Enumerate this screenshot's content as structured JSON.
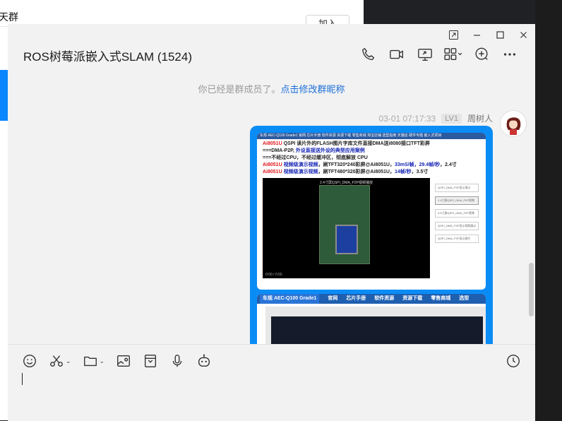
{
  "background_window": {
    "title": "天群",
    "join_label": "加入"
  },
  "window": {
    "title": "ROS树莓派嵌入式SLAM (1524)",
    "controls": [
      "pin-window-icon",
      "minimize-icon",
      "maximize-icon",
      "close-icon"
    ],
    "header_icons": [
      "phone-icon",
      "video-call-icon",
      "screen-share-icon",
      "apps-grid-icon",
      "add-circle-icon",
      "more-icon"
    ]
  },
  "notice": {
    "text": "你已经是群成员了。",
    "link": "点击修改群昵称"
  },
  "message": {
    "timestamp": "03-01 07:17:33",
    "level": "LV1",
    "sender": "周树人",
    "card1": {
      "nav": "车规 AEC-Q100 Grade1    官网    芯片手册    软件资源    资源下载    零售商城    淘宝店铺    选型指南    天猫店    硬件专题    嵌入式项目",
      "lines": [
        {
          "parts": [
            [
              "r",
              "Ai8051U"
            ],
            [
              "k",
              " QSPI"
            ],
            [
              "k",
              " 读片外的FLASH图片字库文件直接DMA送i8080接口TFT彩屏"
            ]
          ]
        },
        {
          "parts": [
            [
              "k",
              "===DMA-P2P, "
            ],
            [
              "b",
              "外设直接送外设的典型应用案例"
            ]
          ]
        },
        {
          "parts": [
            [
              "k",
              "===不经过CPU，不经过缓冲区，彻底解放 CPU"
            ]
          ]
        },
        {
          "parts": [
            [
              "r",
              "Ai8051U "
            ],
            [
              "b",
              "视频级演示视频"
            ],
            [
              "k",
              "，刷TFT320*240彩屏@Ai8051U，"
            ],
            [
              "b",
              "33mS/帧，29.4帧/秒"
            ],
            [
              "k",
              "，2.4寸"
            ]
          ]
        },
        {
          "parts": [
            [
              "r",
              "Ai8051U "
            ],
            [
              "b",
              "视频级演示视频"
            ],
            [
              "k",
              "，刷TFT480*320彩屏@Ai8051U，"
            ],
            [
              "b",
              "14帧/秒"
            ],
            [
              "k",
              "，3.5寸"
            ]
          ]
        }
      ],
      "video_title": "2.4寸屏QSPI_DMA_P2P视频播放",
      "video_time": "0:00 / 0:55",
      "playlist": [
        "QSPI_DMA_P2P显示演示",
        "2.4寸屏QSPI_DMA_P2P视频",
        "3.5寸屏QSPI_DMA_P2P视频",
        "QSPI_DMA_P2P显示视频展示",
        "QSPI_DMA_P2P显示图片"
      ]
    },
    "card2": {
      "nav_items": [
        "车规 AEC-Q100 Grade1",
        "官网",
        "芯片手册",
        "软件资源",
        "资源下载",
        "零售商城",
        "选型"
      ]
    }
  },
  "composer": {
    "tools": [
      "emoji-icon",
      "scissors-icon",
      "folder-icon",
      "image-icon",
      "envelope-icon",
      "microphone-icon",
      "robot-icon"
    ],
    "history_icon": "clock-icon"
  }
}
